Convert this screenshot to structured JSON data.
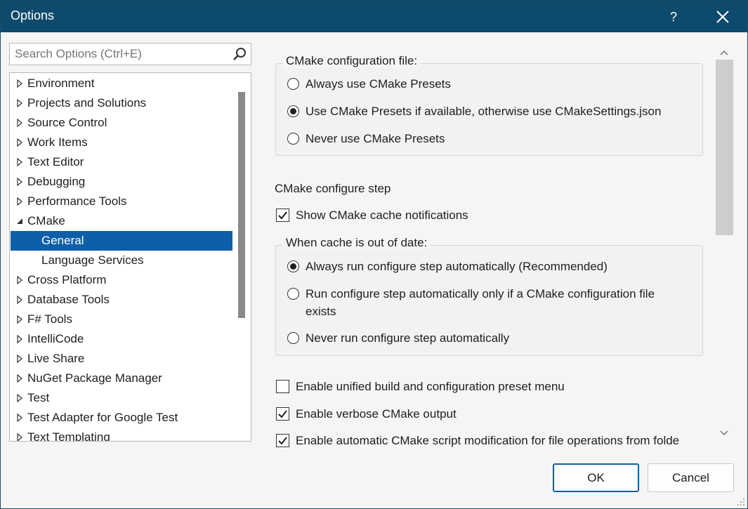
{
  "window": {
    "title": "Options",
    "help_label": "?"
  },
  "search": {
    "placeholder": "Search Options (Ctrl+E)"
  },
  "tree": {
    "items": [
      {
        "label": "Environment",
        "expanded": false,
        "child": false
      },
      {
        "label": "Projects and Solutions",
        "expanded": false,
        "child": false
      },
      {
        "label": "Source Control",
        "expanded": false,
        "child": false
      },
      {
        "label": "Work Items",
        "expanded": false,
        "child": false
      },
      {
        "label": "Text Editor",
        "expanded": false,
        "child": false
      },
      {
        "label": "Debugging",
        "expanded": false,
        "child": false
      },
      {
        "label": "Performance Tools",
        "expanded": false,
        "child": false
      },
      {
        "label": "CMake",
        "expanded": true,
        "child": false
      },
      {
        "label": "General",
        "child": true,
        "selected": true
      },
      {
        "label": "Language Services",
        "child": true
      },
      {
        "label": "Cross Platform",
        "expanded": false,
        "child": false
      },
      {
        "label": "Database Tools",
        "expanded": false,
        "child": false
      },
      {
        "label": "F# Tools",
        "expanded": false,
        "child": false
      },
      {
        "label": "IntelliCode",
        "expanded": false,
        "child": false
      },
      {
        "label": "Live Share",
        "expanded": false,
        "child": false
      },
      {
        "label": "NuGet Package Manager",
        "expanded": false,
        "child": false
      },
      {
        "label": "Test",
        "expanded": false,
        "child": false
      },
      {
        "label": "Test Adapter for Google Test",
        "expanded": false,
        "child": false
      },
      {
        "label": "Text Templating",
        "expanded": false,
        "child": false
      }
    ]
  },
  "config_file": {
    "legend": "CMake configuration file:",
    "options": [
      {
        "label": "Always use CMake Presets",
        "selected": false
      },
      {
        "label": "Use CMake Presets if available, otherwise use CMakeSettings.json",
        "selected": true
      },
      {
        "label": "Never use CMake Presets",
        "selected": false
      }
    ]
  },
  "configure_step": {
    "heading": "CMake configure step",
    "show_cache_notifications": {
      "label": "Show CMake cache notifications",
      "checked": true
    }
  },
  "cache_out_of_date": {
    "legend": "When cache is out of date:",
    "options": [
      {
        "label": "Always run configure step automatically (Recommended)",
        "selected": true
      },
      {
        "label_line1": "Run configure step automatically only if a CMake configuration file",
        "label_line2": "exists",
        "selected": false
      },
      {
        "label": "Never run configure step automatically",
        "selected": false
      }
    ]
  },
  "checkboxes": [
    {
      "label": "Enable unified build and configuration preset menu",
      "checked": false
    },
    {
      "label": "Enable verbose CMake output",
      "checked": true
    },
    {
      "label": "Enable automatic CMake script modification for file operations from folde",
      "checked": true
    }
  ],
  "buttons": {
    "ok": "OK",
    "cancel": "Cancel"
  },
  "colors": {
    "titlebar": "#0e4a6b",
    "selection": "#0e5fa9",
    "window_bg": "#f5f5f5"
  }
}
